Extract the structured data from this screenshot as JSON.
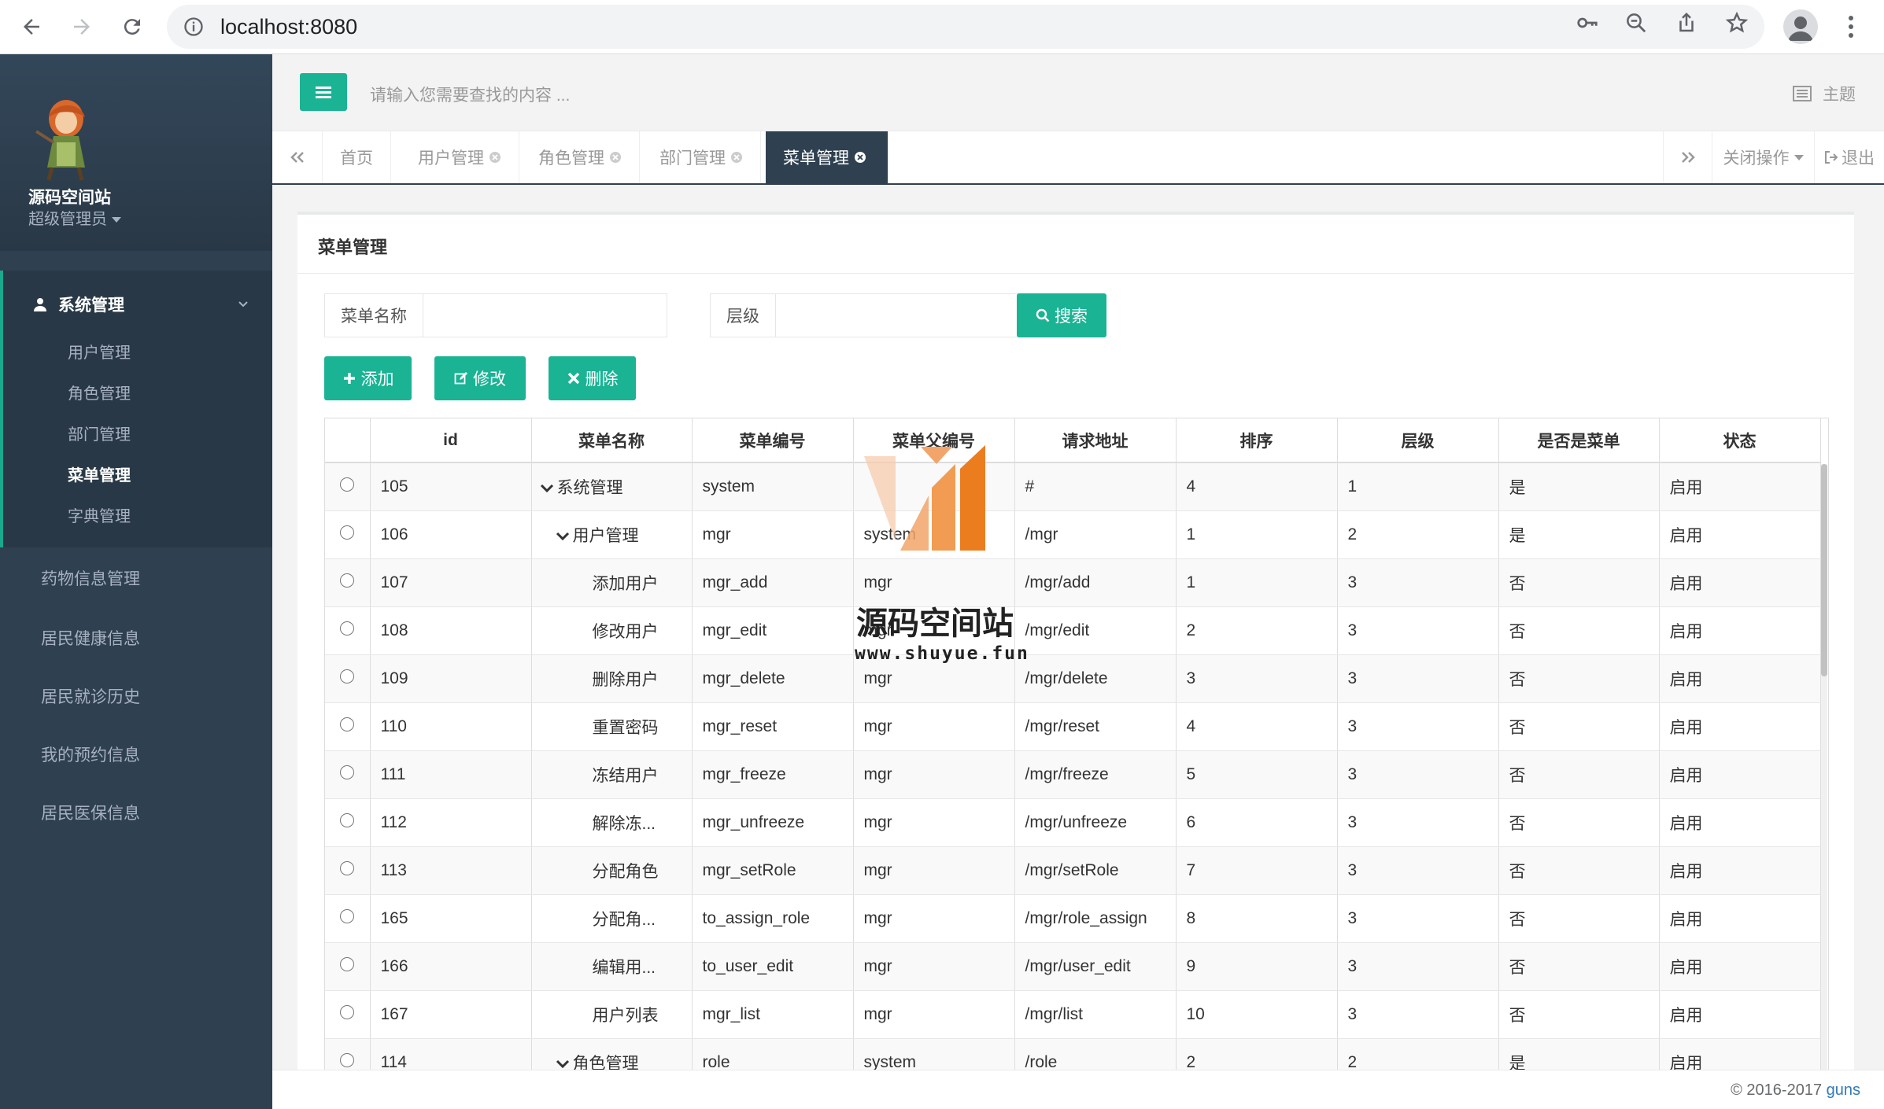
{
  "browser": {
    "url": "localhost:8080"
  },
  "profile": {
    "name": "源码空间站",
    "role": "超级管理员"
  },
  "sidebar": {
    "group_title": "系统管理",
    "sub_items": [
      "用户管理",
      "角色管理",
      "部门管理",
      "菜单管理",
      "字典管理"
    ],
    "active_sub_item": "菜单管理",
    "top_items": [
      "药物信息管理",
      "居民健康信息",
      "居民就诊历史",
      "我的预约信息",
      "居民医保信息"
    ]
  },
  "topbar": {
    "search_placeholder": "请输入您需要查找的内容 ...",
    "theme_label": "主题"
  },
  "tabs": {
    "items": [
      "首页",
      "用户管理",
      "角色管理",
      "部门管理",
      "菜单管理"
    ],
    "active": "菜单管理",
    "close_ops_label": "关闭操作",
    "logout_label": "退出"
  },
  "panel": {
    "title": "菜单管理",
    "filter_name_label": "菜单名称",
    "filter_level_label": "层级",
    "search_button": "搜索",
    "add_button": "添加",
    "edit_button": "修改",
    "delete_button": "删除"
  },
  "table": {
    "columns": [
      "",
      "id",
      "菜单名称",
      "菜单编号",
      "菜单父编号",
      "请求地址",
      "排序",
      "层级",
      "是否是菜单",
      "状态"
    ],
    "rows": [
      {
        "id": "105",
        "name": "系统管理",
        "code": "system",
        "pcode": "",
        "url": "#",
        "sort": "4",
        "level": "1",
        "is_menu": "是",
        "status": "启用",
        "depth": 0,
        "expanded": true
      },
      {
        "id": "106",
        "name": "用户管理",
        "code": "mgr",
        "pcode": "system",
        "url": "/mgr",
        "sort": "1",
        "level": "2",
        "is_menu": "是",
        "status": "启用",
        "depth": 1,
        "expanded": true
      },
      {
        "id": "107",
        "name": "添加用户",
        "code": "mgr_add",
        "pcode": "mgr",
        "url": "/mgr/add",
        "sort": "1",
        "level": "3",
        "is_menu": "否",
        "status": "启用",
        "depth": 2
      },
      {
        "id": "108",
        "name": "修改用户",
        "code": "mgr_edit",
        "pcode": "mgr",
        "url": "/mgr/edit",
        "sort": "2",
        "level": "3",
        "is_menu": "否",
        "status": "启用",
        "depth": 2
      },
      {
        "id": "109",
        "name": "删除用户",
        "code": "mgr_delete",
        "pcode": "mgr",
        "url": "/mgr/delete",
        "sort": "3",
        "level": "3",
        "is_menu": "否",
        "status": "启用",
        "depth": 2
      },
      {
        "id": "110",
        "name": "重置密码",
        "code": "mgr_reset",
        "pcode": "mgr",
        "url": "/mgr/reset",
        "sort": "4",
        "level": "3",
        "is_menu": "否",
        "status": "启用",
        "depth": 2
      },
      {
        "id": "111",
        "name": "冻结用户",
        "code": "mgr_freeze",
        "pcode": "mgr",
        "url": "/mgr/freeze",
        "sort": "5",
        "level": "3",
        "is_menu": "否",
        "status": "启用",
        "depth": 2
      },
      {
        "id": "112",
        "name": "解除冻...",
        "code": "mgr_unfreeze",
        "pcode": "mgr",
        "url": "/mgr/unfreeze",
        "sort": "6",
        "level": "3",
        "is_menu": "否",
        "status": "启用",
        "depth": 2
      },
      {
        "id": "113",
        "name": "分配角色",
        "code": "mgr_setRole",
        "pcode": "mgr",
        "url": "/mgr/setRole",
        "sort": "7",
        "level": "3",
        "is_menu": "否",
        "status": "启用",
        "depth": 2
      },
      {
        "id": "165",
        "name": "分配角...",
        "code": "to_assign_role",
        "pcode": "mgr",
        "url": "/mgr/role_assign",
        "sort": "8",
        "level": "3",
        "is_menu": "否",
        "status": "启用",
        "depth": 2
      },
      {
        "id": "166",
        "name": "编辑用...",
        "code": "to_user_edit",
        "pcode": "mgr",
        "url": "/mgr/user_edit",
        "sort": "9",
        "level": "3",
        "is_menu": "否",
        "status": "启用",
        "depth": 2
      },
      {
        "id": "167",
        "name": "用户列表",
        "code": "mgr_list",
        "pcode": "mgr",
        "url": "/mgr/list",
        "sort": "10",
        "level": "3",
        "is_menu": "否",
        "status": "启用",
        "depth": 2
      },
      {
        "id": "114",
        "name": "角色管理",
        "code": "role",
        "pcode": "system",
        "url": "/role",
        "sort": "2",
        "level": "2",
        "is_menu": "是",
        "status": "启用",
        "depth": 1,
        "expanded": true
      }
    ]
  },
  "watermark": {
    "name": "源码空间站",
    "url": "www.shuyue.fun"
  },
  "footer": {
    "copyright": "© 2016-2017 ",
    "link": "guns"
  },
  "colors": {
    "accent": "#1ab394",
    "sidebar": "#2f4050",
    "active_tab": "#2f4050"
  }
}
